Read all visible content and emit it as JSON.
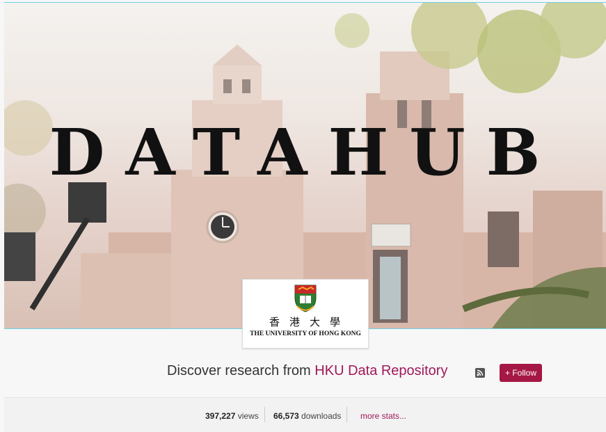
{
  "hero": {
    "title": "DATAHUB"
  },
  "logo": {
    "name_cjk": "香港大學",
    "name_en": "THE UNIVERSITY OF HONG KONG"
  },
  "header": {
    "discover_prefix": "Discover research from ",
    "repository_name": "HKU Data Repository",
    "rss_icon": "rss-icon",
    "follow_label": "+ Follow"
  },
  "stats": {
    "views_count": "397,227",
    "views_label": " views",
    "downloads_count": "66,573",
    "downloads_label": " downloads",
    "more_stats": "more stats..."
  },
  "colors": {
    "accent": "#a51745",
    "brand_text": "#a0185a",
    "hero_border": "#6ed0e0"
  }
}
